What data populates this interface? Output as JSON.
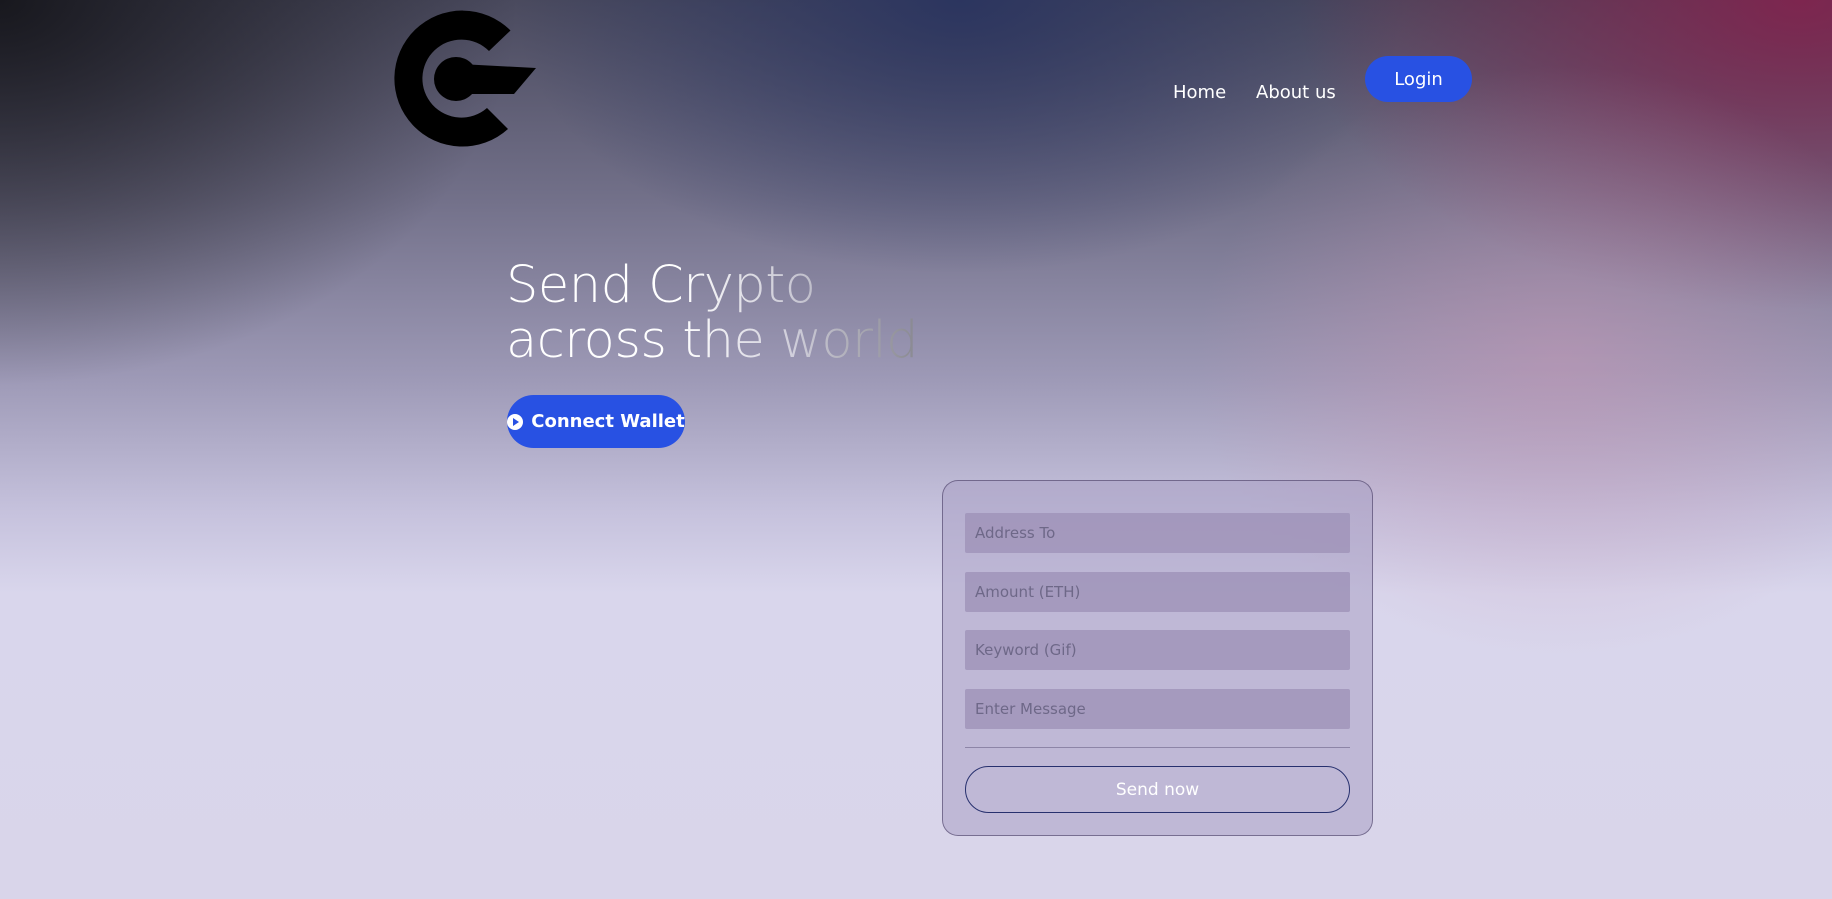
{
  "brand": {
    "logo_icon": "crypto-c-logo-icon",
    "accent_color": "#2851e3"
  },
  "nav": {
    "home_label": "Home",
    "about_label": "About us",
    "login_label": "Login"
  },
  "hero": {
    "title_line1": "Send Crypto",
    "title_line2": "across the world",
    "connect_label": "Connect Wallet",
    "connect_icon": "play-circle-icon"
  },
  "form": {
    "address_placeholder": "Address To",
    "amount_placeholder": "Amount (ETH)",
    "keyword_placeholder": "Keyword (Gif)",
    "message_placeholder": "Enter Message",
    "submit_label": "Send now"
  }
}
